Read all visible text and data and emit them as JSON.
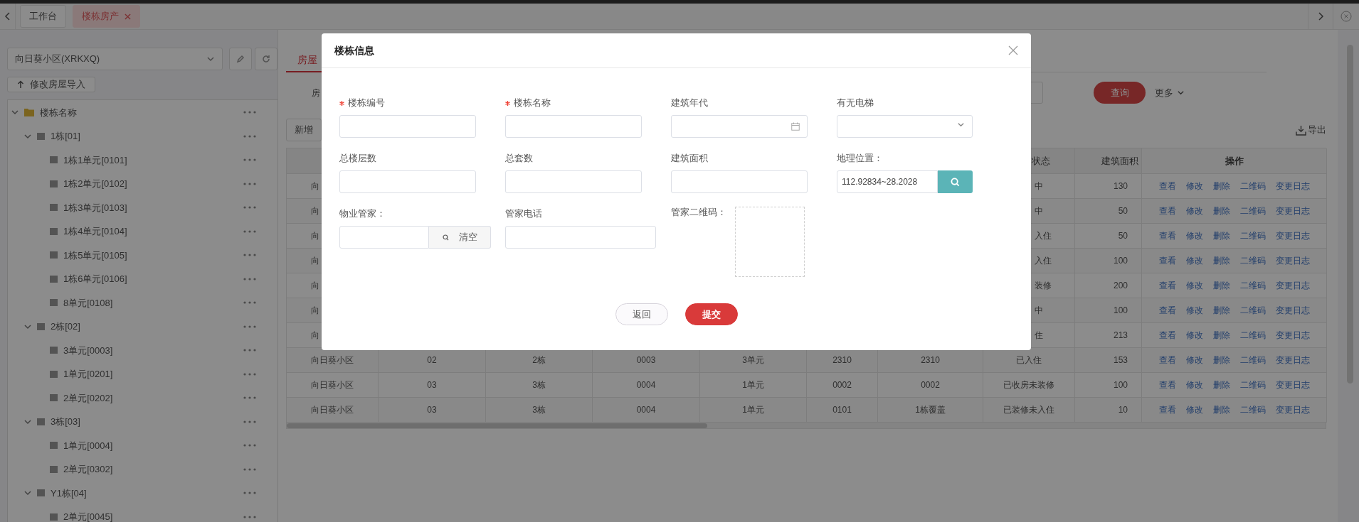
{
  "tab_bar": {
    "tabs": [
      {
        "label": "工作台",
        "selected": false,
        "closable": false
      },
      {
        "label": "楼栋房产",
        "selected": true,
        "closable": true
      }
    ]
  },
  "sidebar": {
    "community_select": {
      "value": "向日葵小区(XRKXQ)"
    },
    "import_button": "修改房屋导入",
    "tree": [
      {
        "label": "楼栋名称",
        "expanded": true,
        "children": [
          {
            "label": "1栋[01]",
            "expanded": true,
            "children": [
              {
                "label": "1栋1单元[0101]"
              },
              {
                "label": "1栋2单元[0102]"
              },
              {
                "label": "1栋3单元[0103]"
              },
              {
                "label": "1栋4单元[0104]"
              },
              {
                "label": "1栋5单元[0105]"
              },
              {
                "label": "1栋6单元[0106]"
              },
              {
                "label": "8单元[0108]"
              }
            ]
          },
          {
            "label": "2栋[02]",
            "expanded": true,
            "children": [
              {
                "label": "3单元[0003]"
              },
              {
                "label": "1单元[0201]"
              },
              {
                "label": "2单元[0202]"
              }
            ]
          },
          {
            "label": "3栋[03]",
            "expanded": true,
            "children": [
              {
                "label": "1单元[0004]"
              },
              {
                "label": "2单元[0302]"
              }
            ]
          },
          {
            "label": "Y1栋[04]",
            "expanded": true,
            "children": [
              {
                "label": "2单元[0045]"
              }
            ]
          }
        ]
      }
    ]
  },
  "main": {
    "tabs": [
      {
        "label": "房屋",
        "selected": true
      }
    ],
    "filter": {
      "label": "房"
    },
    "query_button": "查询",
    "more_button": "更多",
    "add_button": "新增",
    "export_button": "导出",
    "table": {
      "headers": {
        "status": "状态",
        "area": "建筑面积",
        "actions": "操作"
      },
      "rows": [
        {
          "kind": "partial",
          "column_1": "向",
          "status": "中",
          "area": "130",
          "actions": [
            "查看",
            "修改",
            "删除",
            "二维码",
            "变更日志"
          ]
        },
        {
          "kind": "partial",
          "column_1": "向",
          "status": "中",
          "area": "50",
          "actions": [
            "查看",
            "修改",
            "删除",
            "二维码",
            "变更日志"
          ]
        },
        {
          "kind": "partial",
          "column_1": "向",
          "status": "入住",
          "area": "50",
          "actions": [
            "查看",
            "修改",
            "删除",
            "二维码",
            "变更日志"
          ]
        },
        {
          "kind": "partial",
          "column_1": "向",
          "status": "入住",
          "area": "100",
          "actions": [
            "查看",
            "修改",
            "删除",
            "二维码",
            "变更日志"
          ]
        },
        {
          "kind": "partial",
          "column_1": "向",
          "status": "装修",
          "area": "200",
          "actions": [
            "查看",
            "修改",
            "删除",
            "二维码",
            "变更日志"
          ]
        },
        {
          "kind": "partial",
          "column_1": "向",
          "status": "中",
          "area": "100",
          "actions": [
            "查看",
            "修改",
            "删除",
            "二维码",
            "变更日志"
          ]
        },
        {
          "kind": "partial",
          "column_1": "向",
          "status": "住",
          "area": "213",
          "actions": [
            "查看",
            "修改",
            "删除",
            "二维码",
            "变更日志"
          ]
        },
        {
          "kind": "full",
          "cells": [
            "向日葵小区",
            "02",
            "2栋",
            "0003",
            "3单元",
            "2310",
            "2310",
            "已入住"
          ],
          "area": "153",
          "actions": [
            "查看",
            "修改",
            "删除",
            "二维码",
            "变更日志"
          ]
        },
        {
          "kind": "full",
          "cells": [
            "向日葵小区",
            "03",
            "3栋",
            "0004",
            "1单元",
            "0002",
            "0002",
            "已收房未装修"
          ],
          "area": "100",
          "actions": [
            "查看",
            "修改",
            "删除",
            "二维码",
            "变更日志"
          ]
        },
        {
          "kind": "full",
          "cells": [
            "向日葵小区",
            "03",
            "3栋",
            "0004",
            "1单元",
            "0101",
            "1栋覆盖",
            "已装修未入住"
          ],
          "area": "10",
          "actions": [
            "查看",
            "修改",
            "删除",
            "二维码",
            "变更日志"
          ]
        }
      ]
    }
  },
  "modal": {
    "title": "楼栋信息",
    "fields": [
      {
        "kind": "text",
        "label": "楼栋编号",
        "required": true
      },
      {
        "kind": "text",
        "label": "楼栋名称",
        "required": true
      },
      {
        "kind": "date",
        "label": "建筑年代",
        "required": false
      },
      {
        "kind": "select",
        "label": "有无电梯",
        "required": false
      },
      {
        "kind": "text",
        "label": "总楼层数",
        "required": false
      },
      {
        "kind": "text",
        "label": "总套数",
        "required": false
      },
      {
        "kind": "text",
        "label": "建筑面积",
        "required": false
      },
      {
        "kind": "location",
        "label": "地理位置：",
        "required": false,
        "value": "112.92834~28.2028"
      },
      {
        "kind": "picker",
        "label": "物业管家：",
        "required": false,
        "button": "清空"
      },
      {
        "kind": "wide_text",
        "label": "管家电话",
        "required": false
      },
      {
        "kind": "qrcode",
        "label": "管家二维码：",
        "required": false
      }
    ],
    "buttons": [
      {
        "label": "返回",
        "kind": "secondary"
      },
      {
        "label": "提交",
        "kind": "primary"
      }
    ]
  }
}
